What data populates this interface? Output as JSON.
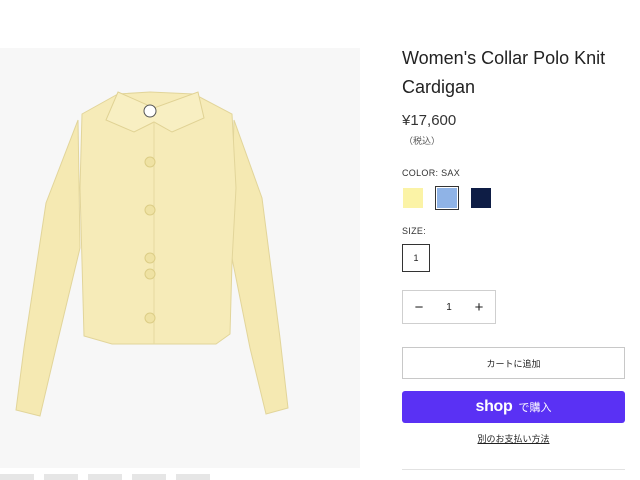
{
  "product": {
    "title": "Women's Collar Polo Knit Cardigan",
    "price": "¥17,600",
    "tax_note": "（税込）"
  },
  "color": {
    "label": "COLOR: SAX",
    "options": [
      {
        "name": "yellow",
        "hex": "#fbf3a6"
      },
      {
        "name": "sax",
        "hex": "#8fb3e6",
        "selected": true
      },
      {
        "name": "navy",
        "hex": "#0e1d45"
      }
    ]
  },
  "size": {
    "label": "SIZE:",
    "value": "1"
  },
  "quantity": {
    "minus": "−",
    "value": "1",
    "plus": "+"
  },
  "buttons": {
    "add_to_cart": "カートに追加",
    "shop_pay_logo": "shop",
    "shop_pay_suffix": "で購入",
    "more_payment": "別のお支払い方法"
  },
  "colors": {
    "accent": "#5a31f4",
    "garment": "#f6ebb8"
  }
}
